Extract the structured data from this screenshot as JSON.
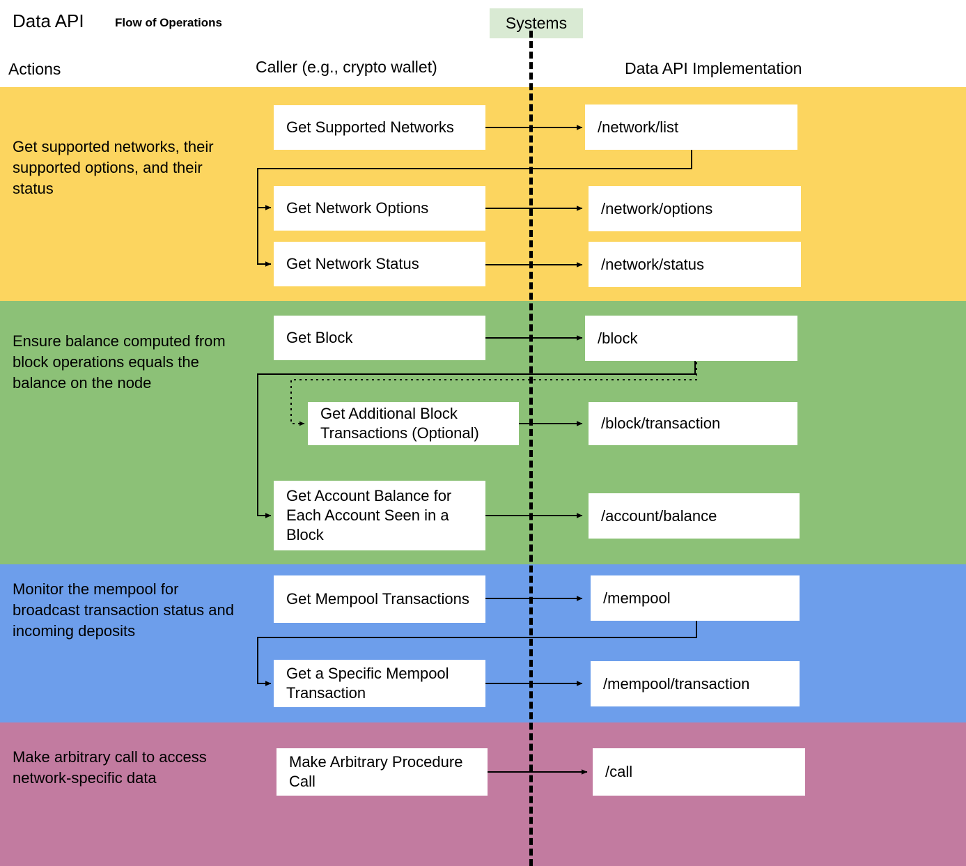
{
  "header": {
    "title": "Data API",
    "subtitle": "Flow of Operations",
    "systems_label": "Systems",
    "col_actions": "Actions",
    "col_caller": "Caller (e.g., crypto wallet)",
    "col_impl": "Data API Implementation"
  },
  "colors": {
    "band_networks": "#fcd55f",
    "band_balance": "#8cc177",
    "band_mempool": "#6d9eeb",
    "band_call": "#c27ba0",
    "systems_box": "#d9ead3",
    "box_fill": "#ffffff",
    "connector": "#000000"
  },
  "bands": [
    {
      "id": "networks",
      "color": "#fcd55f",
      "action": "Get supported networks, their supported options, and their status",
      "caller_steps": [
        "Get Supported Networks",
        "Get Network Options",
        "Get Network Status"
      ],
      "endpoints": [
        "/network/list",
        "/network/options",
        "/network/status"
      ]
    },
    {
      "id": "balance",
      "color": "#8cc177",
      "action": "Ensure balance computed from block operations equals the balance on the node",
      "caller_steps": [
        "Get Block",
        "Get Additional Block Transactions (Optional)",
        "Get Account Balance for Each Account Seen in a Block"
      ],
      "endpoints": [
        "/block",
        "/block/transaction",
        "/account/balance"
      ]
    },
    {
      "id": "mempool",
      "color": "#6d9eeb",
      "action": "Monitor the mempool for broadcast transaction status and incoming deposits",
      "caller_steps": [
        "Get Mempool Transactions",
        "Get a Specific Mempool Transaction"
      ],
      "endpoints": [
        "/mempool",
        "/mempool/transaction"
      ]
    },
    {
      "id": "call",
      "color": "#c27ba0",
      "action": "Make arbitrary call to access network-specific data",
      "caller_steps": [
        "Make Arbitrary Procedure Call"
      ],
      "endpoints": [
        "/call"
      ]
    }
  ]
}
